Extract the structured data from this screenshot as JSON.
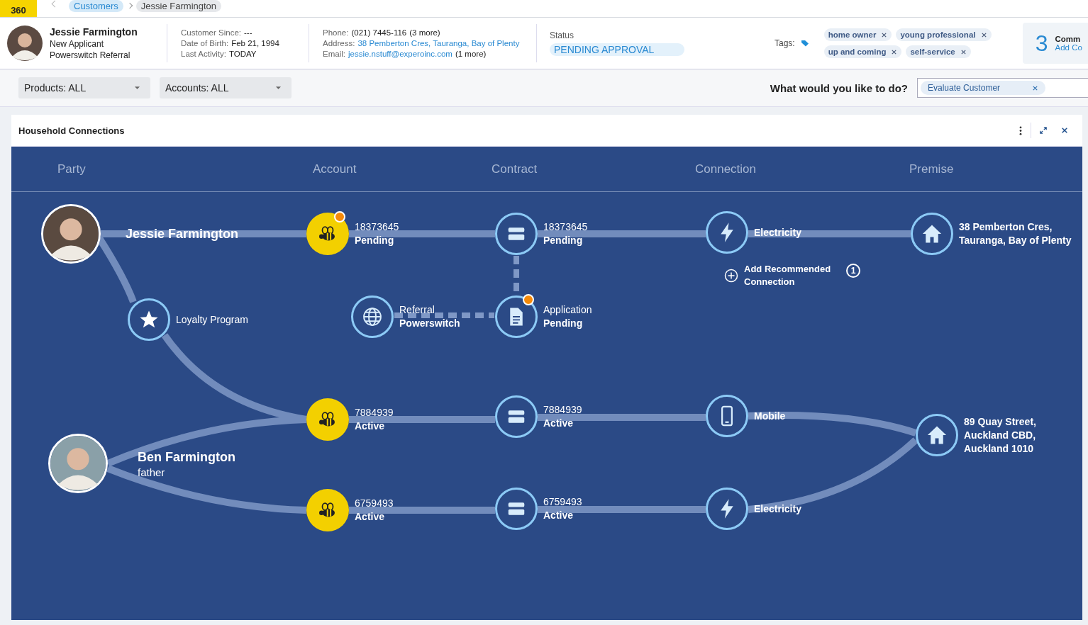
{
  "app": {
    "logo": "360"
  },
  "breadcrumbs": [
    {
      "label": "Customers",
      "current": false
    },
    {
      "label": "Jessie Farmington",
      "current": true
    }
  ],
  "customer": {
    "name": "Jessie Farmington",
    "lines": [
      "New Applicant",
      "Powerswitch Referral"
    ]
  },
  "details": [
    [
      {
        "label": "Customer Since:",
        "value": "---",
        "link": false
      },
      {
        "label": "Date of Birth:",
        "value": "Feb 21, 1994",
        "link": false
      },
      {
        "label": "Last Activity:",
        "value": "TODAY",
        "link": false
      }
    ],
    [
      {
        "label": "Phone:",
        "value": "(021) 7445-116",
        "more": "(3 more)",
        "link": false
      },
      {
        "label": "Address:",
        "value": "38 Pemberton Cres, Tauranga, Bay of Plenty",
        "link": true
      },
      {
        "label": "Email:",
        "value": "jessie.nstuff@experoinc.com",
        "more": "(1 more)",
        "link": true
      }
    ]
  ],
  "status": {
    "label": "Status",
    "value": "PENDING APPROVAL"
  },
  "tags": {
    "label": "Tags:",
    "items": [
      "home owner",
      "young professional",
      "up and coming",
      "self-service"
    ]
  },
  "comments": {
    "count": "3",
    "title": "Comm",
    "link": "Add Co"
  },
  "filters": [
    "Products: ALL",
    "Accounts: ALL"
  ],
  "action": {
    "prompt": "What would you like to do?",
    "value": "Evaluate Customer"
  },
  "panel": {
    "title": "Household Connections",
    "columns": [
      "Party",
      "Account",
      "Contract",
      "Connection",
      "Premise"
    ],
    "nodes": [
      {
        "kind": "party",
        "lines": [
          "Jessie Farmington"
        ],
        "alert": false
      },
      {
        "kind": "loyalty",
        "lines": [
          "Loyalty Program"
        ],
        "alert": false
      },
      {
        "kind": "party",
        "lines": [
          "Ben Farmington",
          "father"
        ],
        "alert": false
      },
      {
        "kind": "account",
        "lines": [
          "18373645",
          "Pending"
        ],
        "alert": true
      },
      {
        "kind": "account",
        "lines": [
          "7884939",
          "Active"
        ],
        "alert": false
      },
      {
        "kind": "account",
        "lines": [
          "6759493",
          "Active"
        ],
        "alert": false
      },
      {
        "kind": "contract",
        "lines": [
          "18373645",
          "Pending"
        ],
        "alert": false
      },
      {
        "kind": "referral",
        "lines": [
          "Referral",
          "Powerswitch"
        ],
        "alert": false
      },
      {
        "kind": "application",
        "lines": [
          "Application",
          "Pending"
        ],
        "alert": true
      },
      {
        "kind": "contract",
        "lines": [
          "7884939",
          "Active"
        ],
        "alert": false
      },
      {
        "kind": "contract",
        "lines": [
          "6759493",
          "Active"
        ],
        "alert": false
      },
      {
        "kind": "electricity",
        "lines": [
          "Electricity"
        ],
        "alert": false
      },
      {
        "kind": "recommend",
        "lines": [
          "Add Recommended",
          "Connection"
        ],
        "count": "1",
        "alert": false
      },
      {
        "kind": "mobile",
        "lines": [
          "Mobile"
        ],
        "alert": false
      },
      {
        "kind": "electricity",
        "lines": [
          "Electricity"
        ],
        "alert": false
      },
      {
        "kind": "premise",
        "lines": [
          "38 Pemberton Cres,",
          "Tauranga, Bay of Plenty"
        ],
        "alert": false
      },
      {
        "kind": "premise",
        "lines": [
          "89 Quay Street,",
          "Auckland CBD,",
          "Auckland 1010"
        ],
        "alert": false
      }
    ]
  }
}
